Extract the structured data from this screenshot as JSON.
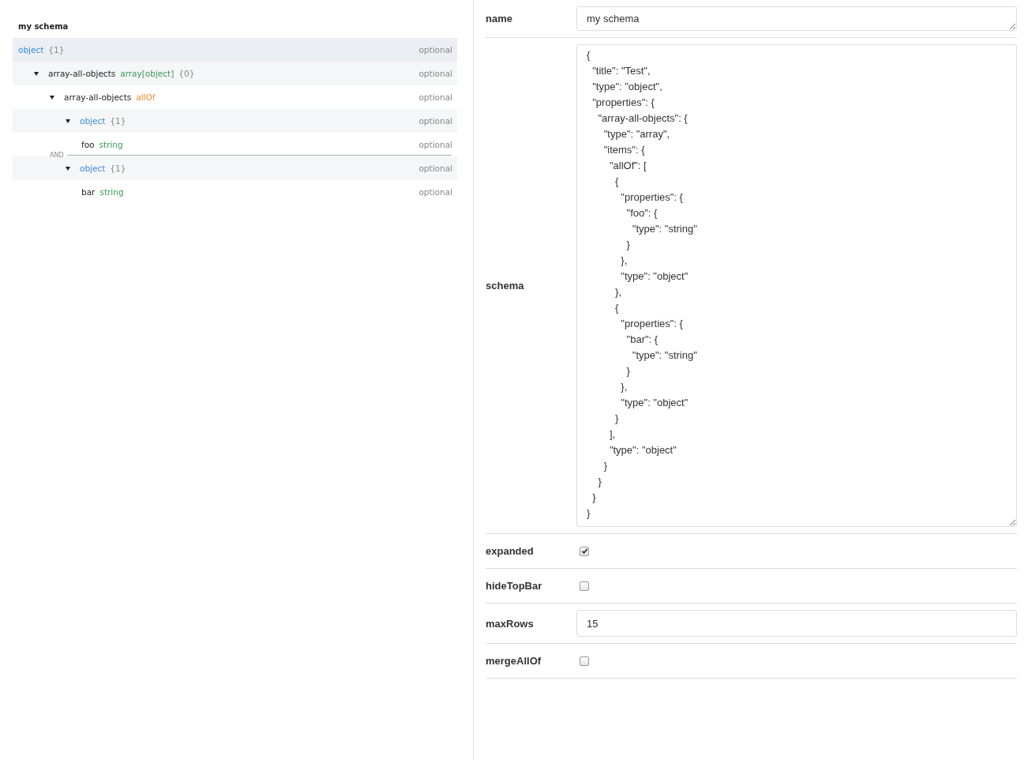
{
  "tree": {
    "title": "my schema",
    "root": {
      "type": "object",
      "kind": "object",
      "count": "{1}",
      "requirement": "optional",
      "selected": true,
      "children": [
        {
          "name": "array-all-objects",
          "type": "array[object]",
          "kind": "primitive",
          "count": "{0}",
          "requirement": "optional",
          "expanded": true,
          "children": [
            {
              "name": "array-all-objects",
              "type": "allOf",
              "kind": "combiner",
              "requirement": "optional",
              "expanded": true,
              "children": [
                {
                  "type": "object",
                  "kind": "object",
                  "count": "{1}",
                  "requirement": "optional",
                  "expanded": true,
                  "children": [
                    {
                      "name": "foo",
                      "type": "string",
                      "kind": "primitive",
                      "requirement": "optional"
                    }
                  ]
                },
                {
                  "separator": "AND",
                  "type": "object",
                  "kind": "object",
                  "count": "{1}",
                  "requirement": "optional",
                  "expanded": true,
                  "children": [
                    {
                      "name": "bar",
                      "type": "string",
                      "kind": "primitive",
                      "requirement": "optional"
                    }
                  ]
                }
              ]
            }
          ]
        }
      ]
    }
  },
  "form": {
    "fields": [
      {
        "label": "name",
        "kind": "text",
        "value": "my schema"
      },
      {
        "label": "schema",
        "kind": "code",
        "value": "{\n  \"title\": \"Test\",\n  \"type\": \"object\",\n  \"properties\": {\n    \"array-all-objects\": {\n      \"type\": \"array\",\n      \"items\": {\n        \"allOf\": [\n          {\n            \"properties\": {\n              \"foo\": {\n                \"type\": \"string\"\n              }\n            },\n            \"type\": \"object\"\n          },\n          {\n            \"properties\": {\n              \"bar\": {\n                \"type\": \"string\"\n              }\n            },\n            \"type\": \"object\"\n          }\n        ],\n        \"type\": \"object\"\n      }\n    }\n  }\n}"
      },
      {
        "label": "expanded",
        "kind": "checkbox",
        "checked": true
      },
      {
        "label": "hideTopBar",
        "kind": "checkbox",
        "checked": false
      },
      {
        "label": "maxRows",
        "kind": "number",
        "value": "15"
      },
      {
        "label": "mergeAllOf",
        "kind": "checkbox",
        "checked": false
      }
    ]
  }
}
